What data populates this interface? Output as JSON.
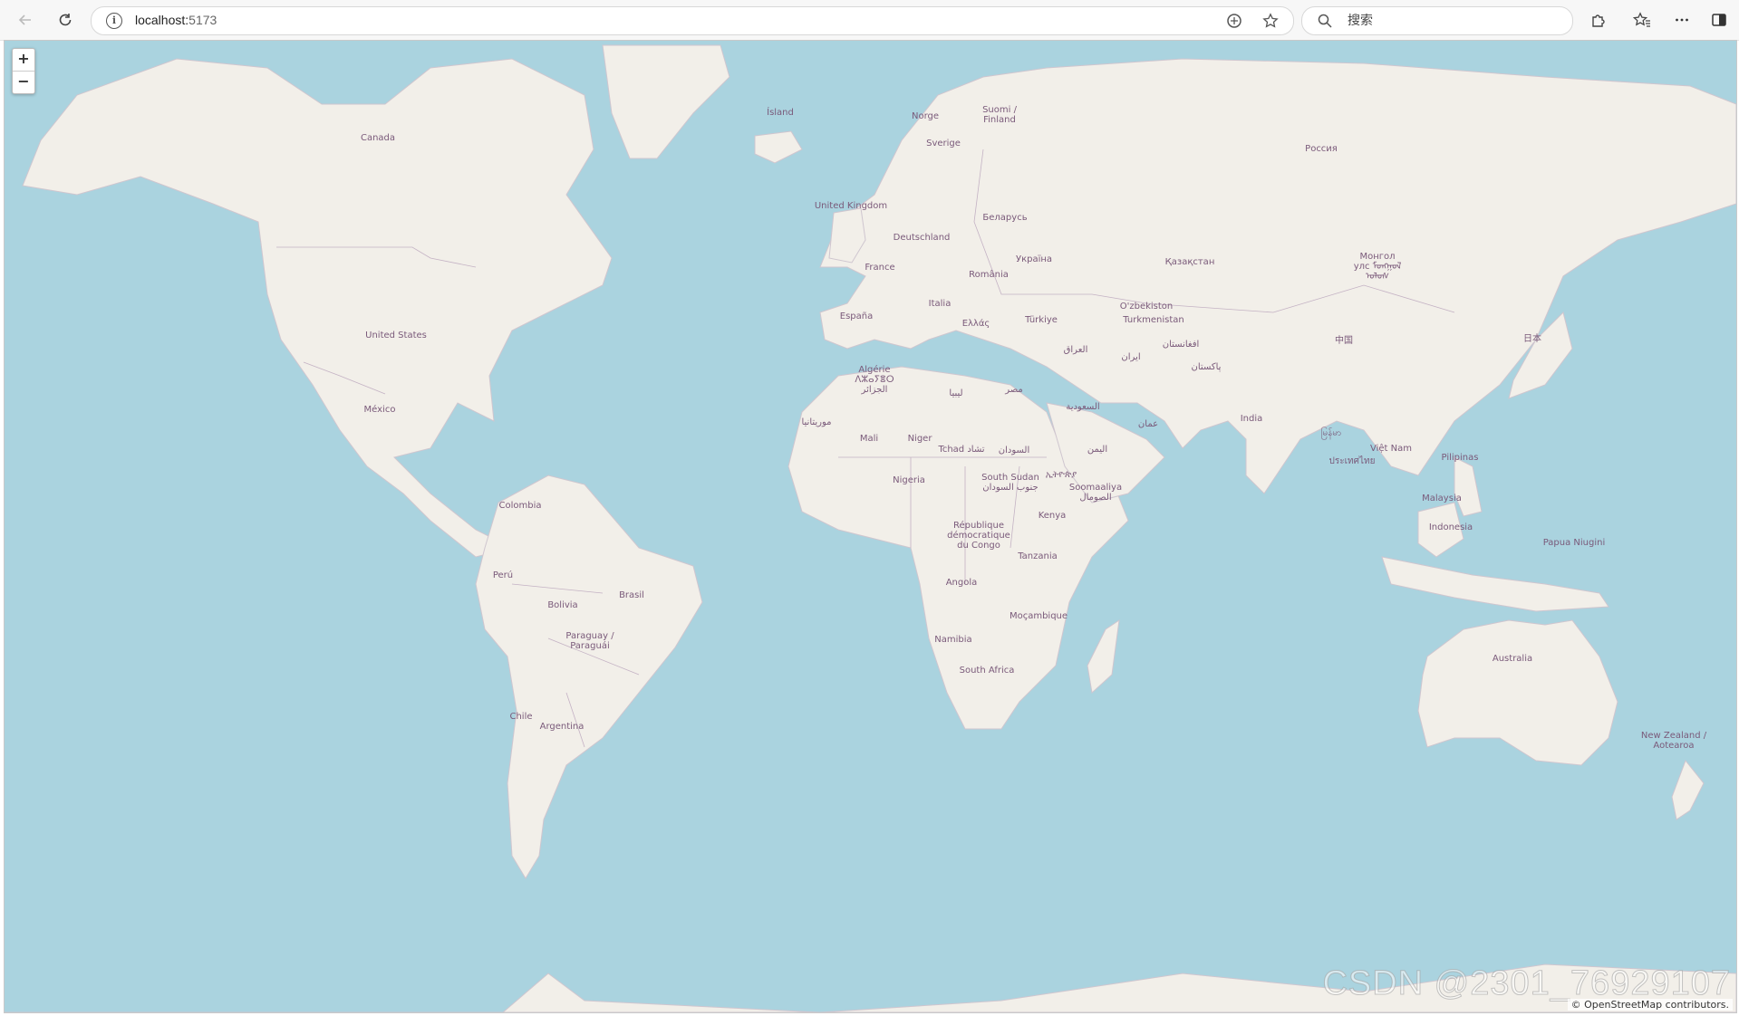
{
  "browser": {
    "url_host": "localhost:",
    "url_port": "5173",
    "search_placeholder": "搜索",
    "back_icon": "arrow-left-icon",
    "refresh_icon": "refresh-icon",
    "info_icon": "info-icon",
    "translate_icon": "translate-icon",
    "favorite_icon": "star-icon",
    "extensions_icon": "puzzle-icon",
    "favorites_icon": "favorites-icon",
    "more_icon": "more-icon",
    "split_icon": "split-screen-icon"
  },
  "map": {
    "zoom_in": "+",
    "zoom_out": "−",
    "attribution": "© OpenStreetMap contributors.",
    "watermark": "CSDN @2301_76929107",
    "colors": {
      "water": "#aad3df",
      "land": "#f2efe9",
      "border": "#b9a9b9",
      "label": "#7a5a7a"
    },
    "labels": [
      {
        "text": "Canada"
      },
      {
        "text": "United States"
      },
      {
        "text": "México"
      },
      {
        "text": "Colombia"
      },
      {
        "text": "Perú"
      },
      {
        "text": "Brasil"
      },
      {
        "text": "Bolivia"
      },
      {
        "text": "Paraguay /\nParaguái"
      },
      {
        "text": "Chile"
      },
      {
        "text": "Argentina"
      },
      {
        "text": "Ísland"
      },
      {
        "text": "Norge"
      },
      {
        "text": "Suomi /\nFinland"
      },
      {
        "text": "Sverige"
      },
      {
        "text": "United Kingdom"
      },
      {
        "text": "Беларусь"
      },
      {
        "text": "Deutschland"
      },
      {
        "text": "France"
      },
      {
        "text": "Україна"
      },
      {
        "text": "România"
      },
      {
        "text": "Italia"
      },
      {
        "text": "España"
      },
      {
        "text": "Ελλάς"
      },
      {
        "text": "Türkiye"
      },
      {
        "text": "Россия"
      },
      {
        "text": "Қазақстан"
      },
      {
        "text": "Монгол\nулс ᠮᠣᠩᠭᠣᠯ\nᠤᠯᠤᠰ"
      },
      {
        "text": "O'zbekiston"
      },
      {
        "text": "Turkmenistan"
      },
      {
        "text": "中国"
      },
      {
        "text": "日本"
      },
      {
        "text": "العراق"
      },
      {
        "text": "ایران"
      },
      {
        "text": "افغانستان"
      },
      {
        "text": "پاکستان"
      },
      {
        "text": "Algérie\nⴷⵣⴰⵢⴻⵔ\nالجزائر"
      },
      {
        "text": "ليبيا"
      },
      {
        "text": "مصر"
      },
      {
        "text": "السعودية"
      },
      {
        "text": "عمان"
      },
      {
        "text": "India"
      },
      {
        "text": "موريتانيا"
      },
      {
        "text": "Mali"
      },
      {
        "text": "Niger"
      },
      {
        "text": "Tchad تشاد"
      },
      {
        "text": "السودان"
      },
      {
        "text": "اليمن"
      },
      {
        "text": "မြန်မာ"
      },
      {
        "text": "Việt Nam"
      },
      {
        "text": "ประเทศไทย"
      },
      {
        "text": "Pilipinas"
      },
      {
        "text": "Nigeria"
      },
      {
        "text": "South Sudan\nجنوب السودان"
      },
      {
        "text": "ኢትዮጵያ"
      },
      {
        "text": "Soomaaliya\nالصومال"
      },
      {
        "text": "Kenya"
      },
      {
        "text": "Malaysia"
      },
      {
        "text": "Indonesia"
      },
      {
        "text": "Papua Niugini"
      },
      {
        "text": "République\ndémocratique\ndu Congo"
      },
      {
        "text": "Tanzania"
      },
      {
        "text": "Angola"
      },
      {
        "text": "Moçambique"
      },
      {
        "text": "Namibia"
      },
      {
        "text": "South Africa"
      },
      {
        "text": "Australia"
      },
      {
        "text": "New Zealand /\nAotearoa"
      }
    ]
  }
}
